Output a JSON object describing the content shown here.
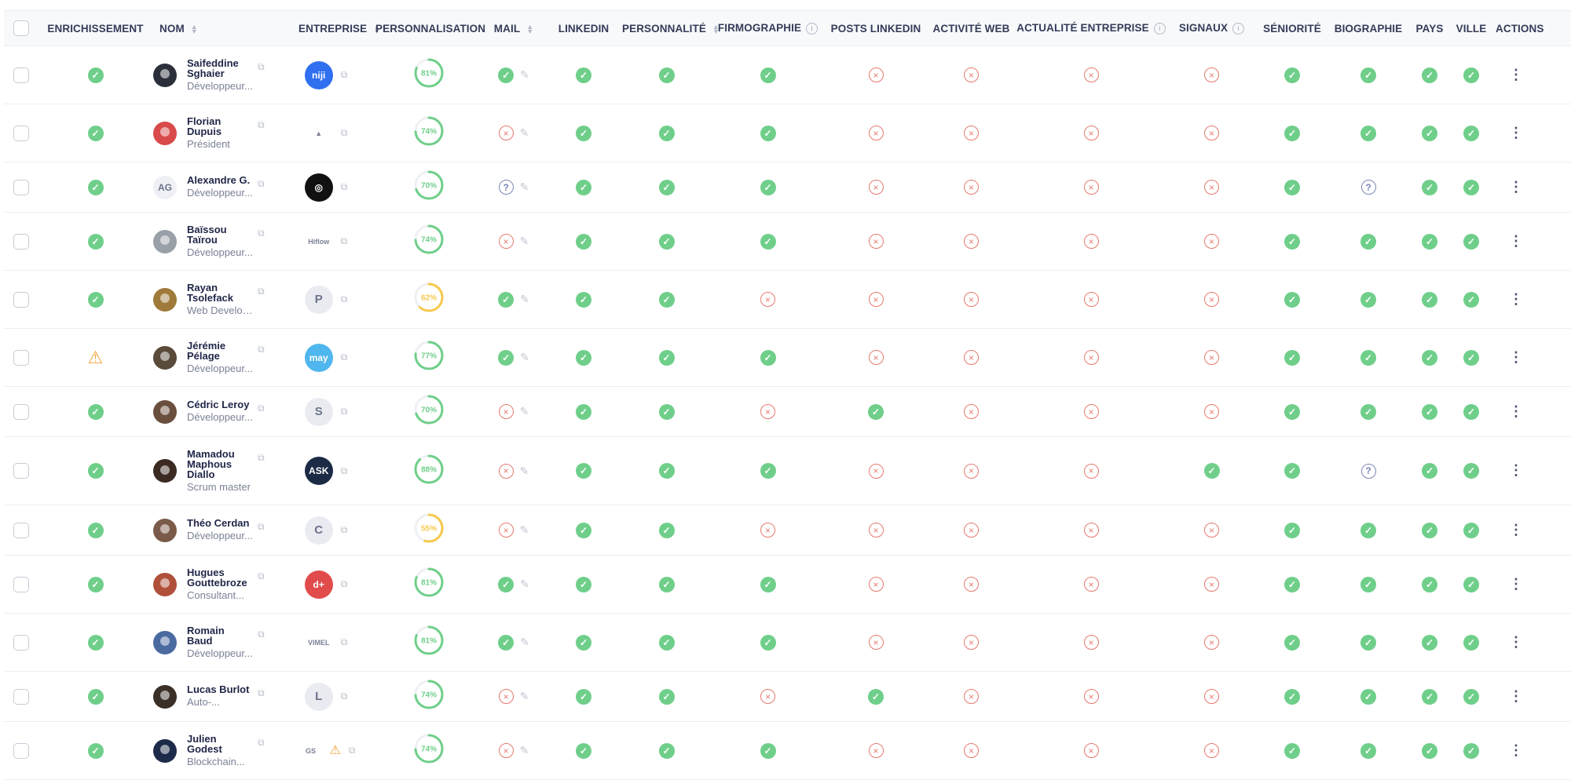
{
  "headers": {
    "enrichissement": "ENRICHISSEMENT",
    "nom": "NOM",
    "entreprise": "ENTREPRISE",
    "personnalisation": "PERSONNALISATION",
    "mail": "MAIL",
    "linkedin": "LINKEDIN",
    "personnalite": "PERSONNALITÉ",
    "firmographie": "FIRMOGRAPHIE",
    "posts_linkedin": "POSTS LINKEDIN",
    "activite_web": "ACTIVITÉ WEB",
    "actualite_entreprise": "ACTUALITÉ ENTREPRISE",
    "signaux": "SIGNAUX",
    "seniorite": "SÉNIORITÉ",
    "biographie": "BIOGRAPHIE",
    "pays": "PAYS",
    "ville": "VILLE",
    "actions": "ACTIONS"
  },
  "colors": {
    "ok": "#6fcf8a",
    "error": "#e57a6e",
    "unknown": "#7a86b8",
    "warning": "#f0a23a",
    "ring_high": "#6fcf8a",
    "ring_mid": "#f6c94a"
  },
  "status_columns": [
    "mail",
    "linkedin",
    "personnalite",
    "firmographie",
    "posts_linkedin",
    "activite_web",
    "actualite_entreprise",
    "signaux",
    "seniorite",
    "biographie",
    "pays",
    "ville"
  ],
  "rows": [
    {
      "name": [
        "Saifeddine",
        "Sghaier"
      ],
      "role": "Développeur...",
      "avatar": {
        "kind": "photo",
        "color": "#2b2f3a"
      },
      "company": {
        "kind": "text",
        "text": "niji",
        "bg": "#2f6ff0"
      },
      "enrichissement": "ok",
      "personnalisation": 81,
      "mail": "ok",
      "linkedin": "ok",
      "personnalite": "ok",
      "firmographie": "ok",
      "posts_linkedin": "error",
      "activite_web": "error",
      "actualite_entreprise": "error",
      "signaux": "error",
      "seniorite": "ok",
      "biographie": "ok",
      "pays": "ok",
      "ville": "ok"
    },
    {
      "name": [
        "Florian",
        "Dupuis"
      ],
      "role": "Président",
      "avatar": {
        "kind": "photo",
        "color": "#d94a4a"
      },
      "company": {
        "kind": "image",
        "text": "▲",
        "bg": "transparent"
      },
      "enrichissement": "ok",
      "personnalisation": 74,
      "mail": "error",
      "linkedin": "ok",
      "personnalite": "ok",
      "firmographie": "ok",
      "posts_linkedin": "error",
      "activite_web": "error",
      "actualite_entreprise": "error",
      "signaux": "error",
      "seniorite": "ok",
      "biographie": "ok",
      "pays": "ok",
      "ville": "ok"
    },
    {
      "name": [
        "Alexandre G."
      ],
      "role": "Développeur...",
      "avatar": {
        "kind": "initials",
        "text": "AG"
      },
      "company": {
        "kind": "text",
        "text": "◎",
        "bg": "#111111"
      },
      "enrichissement": "ok",
      "personnalisation": 70,
      "mail": "unknown",
      "linkedin": "ok",
      "personnalite": "ok",
      "firmographie": "ok",
      "posts_linkedin": "error",
      "activite_web": "error",
      "actualite_entreprise": "error",
      "signaux": "error",
      "seniorite": "ok",
      "biographie": "unknown",
      "pays": "ok",
      "ville": "ok"
    },
    {
      "name": [
        "Baïssou",
        "Taïrou"
      ],
      "role": "Développeur...",
      "avatar": {
        "kind": "photo",
        "color": "#9aa0a8"
      },
      "company": {
        "kind": "image",
        "text": "Hiflow",
        "bg": "transparent"
      },
      "enrichissement": "ok",
      "personnalisation": 74,
      "mail": "error",
      "linkedin": "ok",
      "personnalite": "ok",
      "firmographie": "ok",
      "posts_linkedin": "error",
      "activite_web": "error",
      "actualite_entreprise": "error",
      "signaux": "error",
      "seniorite": "ok",
      "biographie": "ok",
      "pays": "ok",
      "ville": "ok"
    },
    {
      "name": [
        "Rayan",
        "Tsolefack"
      ],
      "role": "Web Developer",
      "avatar": {
        "kind": "photo",
        "color": "#a07a3a"
      },
      "company": {
        "kind": "initials",
        "text": "P"
      },
      "enrichissement": "ok",
      "personnalisation": 62,
      "mail": "ok",
      "linkedin": "ok",
      "personnalite": "ok",
      "firmographie": "error",
      "posts_linkedin": "error",
      "activite_web": "error",
      "actualite_entreprise": "error",
      "signaux": "error",
      "seniorite": "ok",
      "biographie": "ok",
      "pays": "ok",
      "ville": "ok"
    },
    {
      "name": [
        "Jérémie",
        "Pélage"
      ],
      "role": "Développeur...",
      "avatar": {
        "kind": "photo",
        "color": "#5a4a3a"
      },
      "company": {
        "kind": "text",
        "text": "may",
        "bg": "#4fb6ee"
      },
      "enrichissement": "warning",
      "personnalisation": 77,
      "mail": "ok",
      "linkedin": "ok",
      "personnalite": "ok",
      "firmographie": "ok",
      "posts_linkedin": "error",
      "activite_web": "error",
      "actualite_entreprise": "error",
      "signaux": "error",
      "seniorite": "ok",
      "biographie": "ok",
      "pays": "ok",
      "ville": "ok"
    },
    {
      "name": [
        "Cédric Leroy"
      ],
      "role": "Développeur...",
      "avatar": {
        "kind": "photo",
        "color": "#6a4e3e"
      },
      "company": {
        "kind": "initials",
        "text": "S"
      },
      "enrichissement": "ok",
      "personnalisation": 70,
      "mail": "error",
      "linkedin": "ok",
      "personnalite": "ok",
      "firmographie": "error",
      "posts_linkedin": "ok",
      "activite_web": "error",
      "actualite_entreprise": "error",
      "signaux": "error",
      "seniorite": "ok",
      "biographie": "ok",
      "pays": "ok",
      "ville": "ok"
    },
    {
      "name": [
        "Mamadou",
        "Maphous",
        "Diallo"
      ],
      "role": "Scrum master",
      "avatar": {
        "kind": "photo",
        "color": "#3a2a22"
      },
      "company": {
        "kind": "text",
        "text": "ASK",
        "bg": "#1b2a45"
      },
      "enrichissement": "ok",
      "personnalisation": 88,
      "mail": "error",
      "linkedin": "ok",
      "personnalite": "ok",
      "firmographie": "ok",
      "posts_linkedin": "error",
      "activite_web": "error",
      "actualite_entreprise": "error",
      "signaux": "ok",
      "seniorite": "ok",
      "biographie": "unknown",
      "pays": "ok",
      "ville": "ok"
    },
    {
      "name": [
        "Théo Cerdan"
      ],
      "role": "Développeur...",
      "avatar": {
        "kind": "photo",
        "color": "#7a5a48"
      },
      "company": {
        "kind": "initials",
        "text": "C"
      },
      "enrichissement": "ok",
      "personnalisation": 55,
      "mail": "error",
      "linkedin": "ok",
      "personnalite": "ok",
      "firmographie": "error",
      "posts_linkedin": "error",
      "activite_web": "error",
      "actualite_entreprise": "error",
      "signaux": "error",
      "seniorite": "ok",
      "biographie": "ok",
      "pays": "ok",
      "ville": "ok"
    },
    {
      "name": [
        "Hugues",
        "Gouttebroze"
      ],
      "role": "Consultant...",
      "avatar": {
        "kind": "photo",
        "color": "#b0503a"
      },
      "company": {
        "kind": "text",
        "text": "d+",
        "bg": "#e24b4b"
      },
      "enrichissement": "ok",
      "personnalisation": 81,
      "mail": "ok",
      "linkedin": "ok",
      "personnalite": "ok",
      "firmographie": "ok",
      "posts_linkedin": "error",
      "activite_web": "error",
      "actualite_entreprise": "error",
      "signaux": "error",
      "seniorite": "ok",
      "biographie": "ok",
      "pays": "ok",
      "ville": "ok"
    },
    {
      "name": [
        "Romain",
        "Baud"
      ],
      "role": "Développeur...",
      "avatar": {
        "kind": "photo",
        "color": "#4a6aa0"
      },
      "company": {
        "kind": "image",
        "text": "VIMEL",
        "bg": "transparent"
      },
      "enrichissement": "ok",
      "personnalisation": 81,
      "mail": "ok",
      "linkedin": "ok",
      "personnalite": "ok",
      "firmographie": "ok",
      "posts_linkedin": "error",
      "activite_web": "error",
      "actualite_entreprise": "error",
      "signaux": "error",
      "seniorite": "ok",
      "biographie": "ok",
      "pays": "ok",
      "ville": "ok"
    },
    {
      "name": [
        "Lucas Burlot"
      ],
      "role": "Auto-...",
      "avatar": {
        "kind": "photo",
        "color": "#3a3028"
      },
      "company": {
        "kind": "initials",
        "text": "L"
      },
      "enrichissement": "ok",
      "personnalisation": 74,
      "mail": "error",
      "linkedin": "ok",
      "personnalite": "ok",
      "firmographie": "error",
      "posts_linkedin": "ok",
      "activite_web": "error",
      "actualite_entreprise": "error",
      "signaux": "error",
      "seniorite": "ok",
      "biographie": "ok",
      "pays": "ok",
      "ville": "ok"
    },
    {
      "name": [
        "Julien",
        "Godest"
      ],
      "role": "Blockchain...",
      "avatar": {
        "kind": "photo",
        "color": "#1e2a4a"
      },
      "company": {
        "kind": "image",
        "text": "GS",
        "bg": "transparent",
        "warning": true
      },
      "enrichissement": "ok",
      "personnalisation": 74,
      "mail": "error",
      "linkedin": "ok",
      "personnalite": "ok",
      "firmographie": "ok",
      "posts_linkedin": "error",
      "activite_web": "error",
      "actualite_entreprise": "error",
      "signaux": "error",
      "seniorite": "ok",
      "biographie": "ok",
      "pays": "ok",
      "ville": "ok"
    }
  ]
}
